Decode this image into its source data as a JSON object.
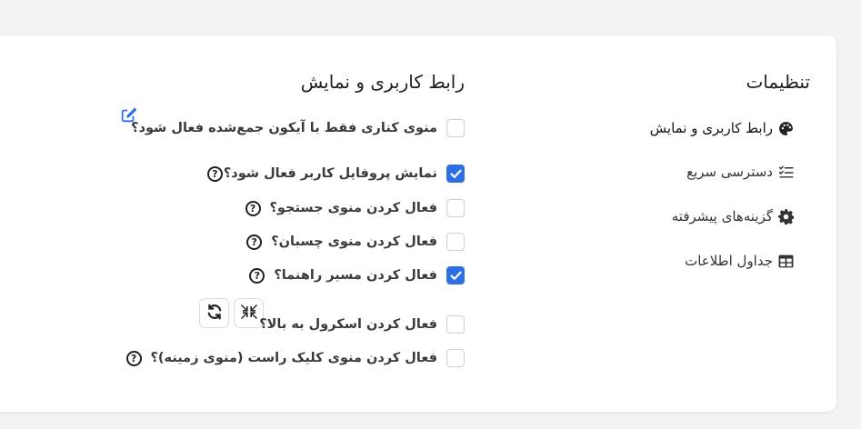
{
  "sidebar": {
    "title": "تنظیمات",
    "items": [
      {
        "label": "رابط کاربری و نمایش",
        "icon": "palette-icon"
      },
      {
        "label": "دسترسی سریع",
        "icon": "list-check-icon"
      },
      {
        "label": "گزینه‌های پیشرفته",
        "icon": "gear-icon"
      },
      {
        "label": "جداول اطلاعات",
        "icon": "table-icon"
      }
    ]
  },
  "main": {
    "title": "رابط کاربری و نمایش",
    "options": [
      {
        "label": "منوی کناری فقط با آیکون جمع‌شده فعال شود؟",
        "checked": false
      },
      {
        "label": "نمایش پروفایل کاربر فعال شود؟",
        "checked": true
      },
      {
        "label": "فعال کردن منوی جستجو؟",
        "checked": false
      },
      {
        "label": "فعال کردن منوی چسبان؟",
        "checked": false
      },
      {
        "label": "فعال کردن مسیر راهنما؟",
        "checked": true
      },
      {
        "label": "فعال کردن اسکرول به بالا؟",
        "checked": false
      },
      {
        "label": "فعال کردن منوی کلیک راست (منوی زمینه)؟",
        "checked": false
      }
    ],
    "help_glyph": "?",
    "accent_color": "#2f6fe4"
  }
}
